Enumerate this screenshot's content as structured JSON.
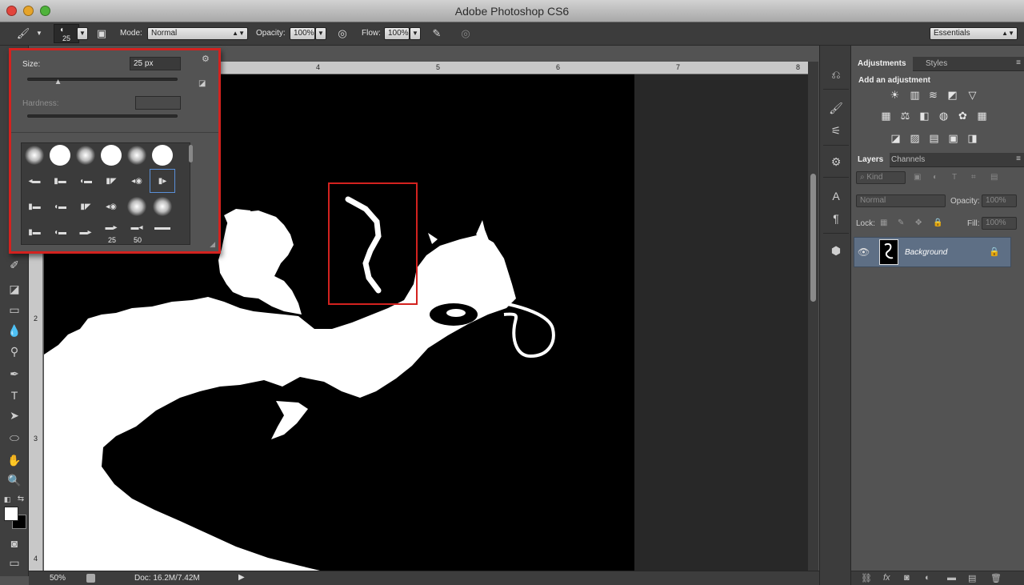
{
  "window": {
    "title": "Adobe Photoshop CS6"
  },
  "options_bar": {
    "brush_size": "25",
    "mode_label": "Mode:",
    "mode_value": "Normal",
    "opacity_label": "Opacity:",
    "opacity_value": "100%",
    "flow_label": "Flow:",
    "flow_value": "100%",
    "workspace": "Essentials"
  },
  "brush_popup": {
    "size_label": "Size:",
    "size_value": "25 px",
    "hardness_label": "Hardness:",
    "size_slider_fraction": 0.2,
    "preset_numbers": [
      "25",
      "50"
    ]
  },
  "rulers": {
    "top": [
      "4",
      "5",
      "6",
      "7",
      "8"
    ],
    "left": [
      "2",
      "3",
      "4"
    ]
  },
  "status": {
    "zoom": "50%",
    "doc": "Doc: 16.2M/7.42M"
  },
  "adjustments": {
    "tabs": [
      "Adjustments",
      "Styles"
    ],
    "heading": "Add an adjustment",
    "icons_row1": [
      "☀",
      "▥",
      "≋",
      "◩",
      "▽"
    ],
    "icons_row2": [
      "▦",
      "⚖",
      "◧",
      "◍",
      "✿",
      "▦"
    ],
    "icons_row3": [
      "◪",
      "▨",
      "▤",
      "▣",
      "◨"
    ]
  },
  "layers": {
    "tabs": [
      "Layers",
      "Channels"
    ],
    "filter_kind": "Kind",
    "blend_mode": "Normal",
    "opacity_label": "Opacity:",
    "opacity_value": "100%",
    "lock_label": "Lock:",
    "fill_label": "Fill:",
    "fill_value": "100%",
    "layer_name": "Background"
  },
  "colors": {
    "highlight": "#d3221f",
    "selected_layer": "#5e6f85",
    "foreground": "#ffffff",
    "background": "#000000"
  }
}
